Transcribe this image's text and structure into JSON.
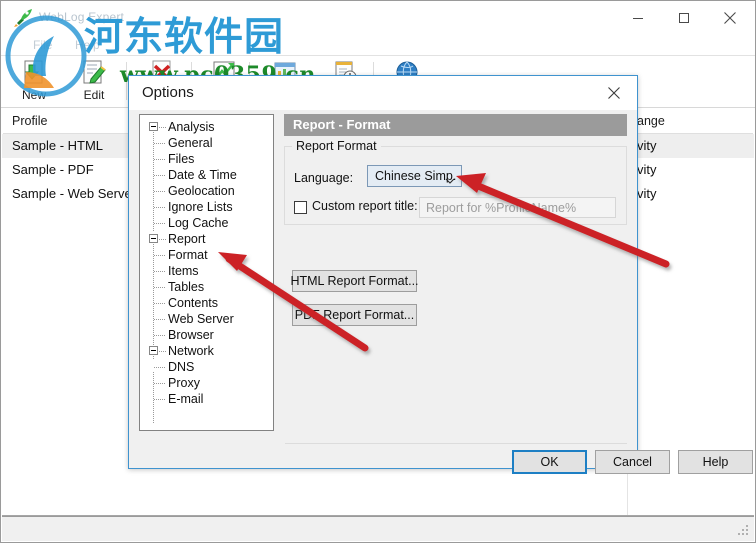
{
  "app": {
    "title": "WebLog Expert",
    "icon": "app-rocket-icon",
    "window_buttons": {
      "minimize": "minimize-icon",
      "maximize": "maximize-icon",
      "close": "close-icon"
    }
  },
  "menubar": {
    "items": [
      {
        "label": "File"
      },
      {
        "label": "Help"
      }
    ]
  },
  "toolbar": {
    "items": [
      {
        "label": "New",
        "icon": "new-profile-icon"
      },
      {
        "label": "Edit",
        "icon": "edit-profile-icon"
      },
      {
        "label": "",
        "icon": "delete-profile-icon"
      },
      {
        "label": "",
        "icon": "analyze-icon"
      },
      {
        "label": "",
        "icon": "report-icon"
      },
      {
        "label": "",
        "icon": "schedule-icon"
      },
      {
        "label": "",
        "icon": "globe-icon"
      }
    ]
  },
  "profile_list": {
    "columns": [
      {
        "label": "Profile"
      },
      {
        "label": "ange"
      }
    ],
    "rows": [
      {
        "name": "Sample - HTML",
        "range": "vity",
        "selected": true
      },
      {
        "name": "Sample - PDF",
        "range": "vity",
        "selected": false
      },
      {
        "name": "Sample - Web Serve",
        "range": "vity",
        "selected": false
      }
    ]
  },
  "watermark": {
    "chinese": "河东软件园",
    "url": "www.pc0359.cn",
    "logo_icon": "watermark-logo-icon"
  },
  "dialog": {
    "title": "Options",
    "close_icon": "close-icon",
    "tree": [
      {
        "label": "Analysis",
        "level": 0,
        "expander": true,
        "selected": false
      },
      {
        "label": "General",
        "level": 1,
        "expander": false,
        "selected": false
      },
      {
        "label": "Files",
        "level": 1,
        "expander": false,
        "selected": false
      },
      {
        "label": "Date & Time",
        "level": 1,
        "expander": false,
        "selected": false
      },
      {
        "label": "Geolocation",
        "level": 1,
        "expander": false,
        "selected": false
      },
      {
        "label": "Ignore Lists",
        "level": 1,
        "expander": false,
        "selected": false
      },
      {
        "label": "Log Cache",
        "level": 1,
        "expander": false,
        "selected": false
      },
      {
        "label": "Report",
        "level": 0,
        "expander": true,
        "selected": false
      },
      {
        "label": "Format",
        "level": 1,
        "expander": false,
        "selected": true
      },
      {
        "label": "Items",
        "level": 1,
        "expander": false,
        "selected": false
      },
      {
        "label": "Tables",
        "level": 1,
        "expander": false,
        "selected": false
      },
      {
        "label": "Contents",
        "level": 1,
        "expander": false,
        "selected": false
      },
      {
        "label": "Web Server",
        "level": 1,
        "expander": false,
        "selected": false
      },
      {
        "label": "Browser",
        "level": 1,
        "expander": false,
        "selected": false
      },
      {
        "label": "Network",
        "level": 0,
        "expander": true,
        "selected": false
      },
      {
        "label": "DNS",
        "level": 1,
        "expander": false,
        "selected": false
      },
      {
        "label": "Proxy",
        "level": 1,
        "expander": false,
        "selected": false
      },
      {
        "label": "E-mail",
        "level": 1,
        "expander": false,
        "selected": false
      }
    ],
    "pane": {
      "header": "Report - Format",
      "group_legend": "Report Format",
      "language_label": "Language:",
      "language_value": "Chinese Simp.",
      "custom_title_label": "Custom report title:",
      "custom_title_checked": false,
      "custom_title_placeholder": "Report for %ProfileName%",
      "html_button": "HTML Report Format...",
      "pdf_button": "PDF Report Format..."
    },
    "footer": {
      "ok": "OK",
      "cancel": "Cancel",
      "help": "Help"
    }
  },
  "annotations": {
    "arrow_color": "#cc2026",
    "arrows": [
      {
        "name": "arrow-to-format-tree-item"
      },
      {
        "name": "arrow-to-language-combo"
      }
    ]
  }
}
